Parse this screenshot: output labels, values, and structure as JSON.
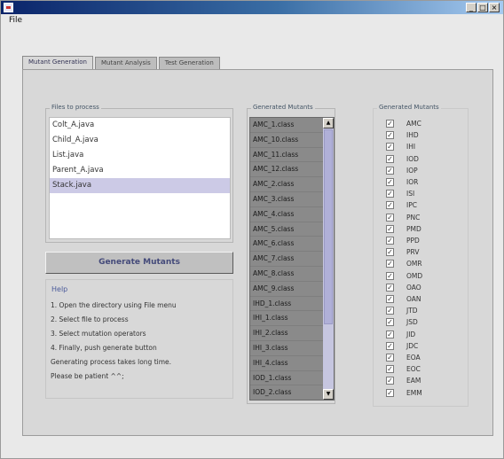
{
  "window": {
    "title": "",
    "controls": [
      "_",
      "□",
      "×"
    ]
  },
  "menu": {
    "file": "File"
  },
  "tabs": [
    {
      "label": "Mutant Generation",
      "active": true
    },
    {
      "label": "Mutant Analysis",
      "active": false
    },
    {
      "label": "Test Generation",
      "active": false
    }
  ],
  "files": {
    "title": "Files to process",
    "items": [
      "Colt_A.java",
      "Child_A.java",
      "List.java",
      "Parent_A.java",
      "Stack.java"
    ],
    "selected_index": 4
  },
  "generate_button": "Generate Mutants",
  "help": {
    "title": "Help",
    "lines": [
      "1. Open the directory using File menu",
      "2. Select file to process",
      "3. Select mutation operators",
      "4. Finally, push generate button",
      "Generating process takes long time.",
      "Please be patient ^^;"
    ]
  },
  "generated_mutants": {
    "title": "Generated Mutants",
    "items": [
      "AMC_1.class",
      "AMC_10.class",
      "AMC_11.class",
      "AMC_12.class",
      "AMC_2.class",
      "AMC_3.class",
      "AMC_4.class",
      "AMC_5.class",
      "AMC_6.class",
      "AMC_7.class",
      "AMC_8.class",
      "AMC_9.class",
      "IHD_1.class",
      "IHI_1.class",
      "IHI_2.class",
      "IHI_3.class",
      "IHI_4.class",
      "IOD_1.class",
      "IOD_2.class"
    ]
  },
  "operators": {
    "title": "Generated Mutants",
    "items": [
      "AMC",
      "IHD",
      "IHI",
      "IOD",
      "IOP",
      "IOR",
      "ISI",
      "IPC",
      "PNC",
      "PMD",
      "PPD",
      "PRV",
      "OMR",
      "OMD",
      "OAO",
      "OAN",
      "JTD",
      "JSD",
      "JID",
      "JDC",
      "EOA",
      "EOC",
      "EAM",
      "EMM"
    ],
    "checked": true
  }
}
